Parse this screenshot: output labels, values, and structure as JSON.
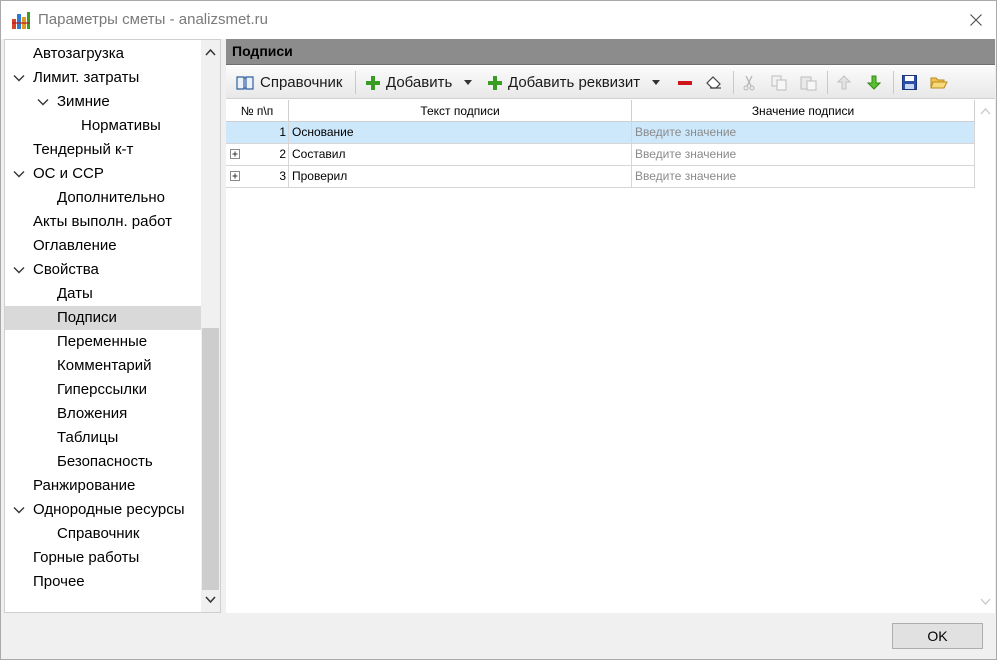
{
  "window": {
    "title": "Параметры сметы - analizsmet.ru"
  },
  "tree": {
    "items": [
      {
        "label": "Автозагрузка",
        "level": 0,
        "expander": "none",
        "selected": false
      },
      {
        "label": "Лимит. затраты",
        "level": 0,
        "expander": "expanded",
        "selected": false
      },
      {
        "label": "Зимние",
        "level": 1,
        "expander": "expanded",
        "selected": false
      },
      {
        "label": "Нормативы",
        "level": 2,
        "expander": "none",
        "selected": false
      },
      {
        "label": "Тендерный к-т",
        "level": 0,
        "expander": "none",
        "selected": false
      },
      {
        "label": "ОС и ССР",
        "level": 0,
        "expander": "expanded",
        "selected": false
      },
      {
        "label": "Дополнительно",
        "level": 1,
        "expander": "none",
        "selected": false
      },
      {
        "label": "Акты выполн. работ",
        "level": 0,
        "expander": "none",
        "selected": false
      },
      {
        "label": "Оглавление",
        "level": 0,
        "expander": "none",
        "selected": false
      },
      {
        "label": "Свойства",
        "level": 0,
        "expander": "expanded",
        "selected": false
      },
      {
        "label": "Даты",
        "level": 1,
        "expander": "none",
        "selected": false
      },
      {
        "label": "Подписи",
        "level": 1,
        "expander": "none",
        "selected": true
      },
      {
        "label": "Переменные",
        "level": 1,
        "expander": "none",
        "selected": false
      },
      {
        "label": "Комментарий",
        "level": 1,
        "expander": "none",
        "selected": false
      },
      {
        "label": "Гиперссылки",
        "level": 1,
        "expander": "none",
        "selected": false
      },
      {
        "label": "Вложения",
        "level": 1,
        "expander": "none",
        "selected": false
      },
      {
        "label": "Таблицы",
        "level": 1,
        "expander": "none",
        "selected": false
      },
      {
        "label": "Безопасность",
        "level": 1,
        "expander": "none",
        "selected": false
      },
      {
        "label": "Ранжирование",
        "level": 0,
        "expander": "none",
        "selected": false
      },
      {
        "label": "Однородные ресурсы",
        "level": 0,
        "expander": "expanded",
        "selected": false
      },
      {
        "label": "Справочник",
        "level": 1,
        "expander": "none",
        "selected": false
      },
      {
        "label": "Горные работы",
        "level": 0,
        "expander": "none",
        "selected": false
      },
      {
        "label": "Прочее",
        "level": 0,
        "expander": "none",
        "selected": false
      }
    ]
  },
  "panel": {
    "title": "Подписи",
    "toolbar": {
      "reference_label": "Справочник",
      "add_label": "Добавить",
      "add_requisite_label": "Добавить реквизит"
    },
    "grid": {
      "columns": [
        "№ п\\п",
        "Текст подписи",
        "Значение подписи"
      ],
      "rows": [
        {
          "num": "1",
          "text": "Основание",
          "value_placeholder": "Введите значение",
          "expandable": false,
          "selected": true
        },
        {
          "num": "2",
          "text": "Составил",
          "value_placeholder": "Введите значение",
          "expandable": true,
          "selected": false
        },
        {
          "num": "3",
          "text": "Проверил",
          "value_placeholder": "Введите значение",
          "expandable": true,
          "selected": false
        }
      ]
    }
  },
  "footer": {
    "ok_label": "OK"
  },
  "colors": {
    "selection": "#cde8fb",
    "tree_selected": "#d9d9d9",
    "panel_header": "#8c8c8c",
    "add_green": "#3a9d23",
    "delete_red": "#d0141c"
  }
}
